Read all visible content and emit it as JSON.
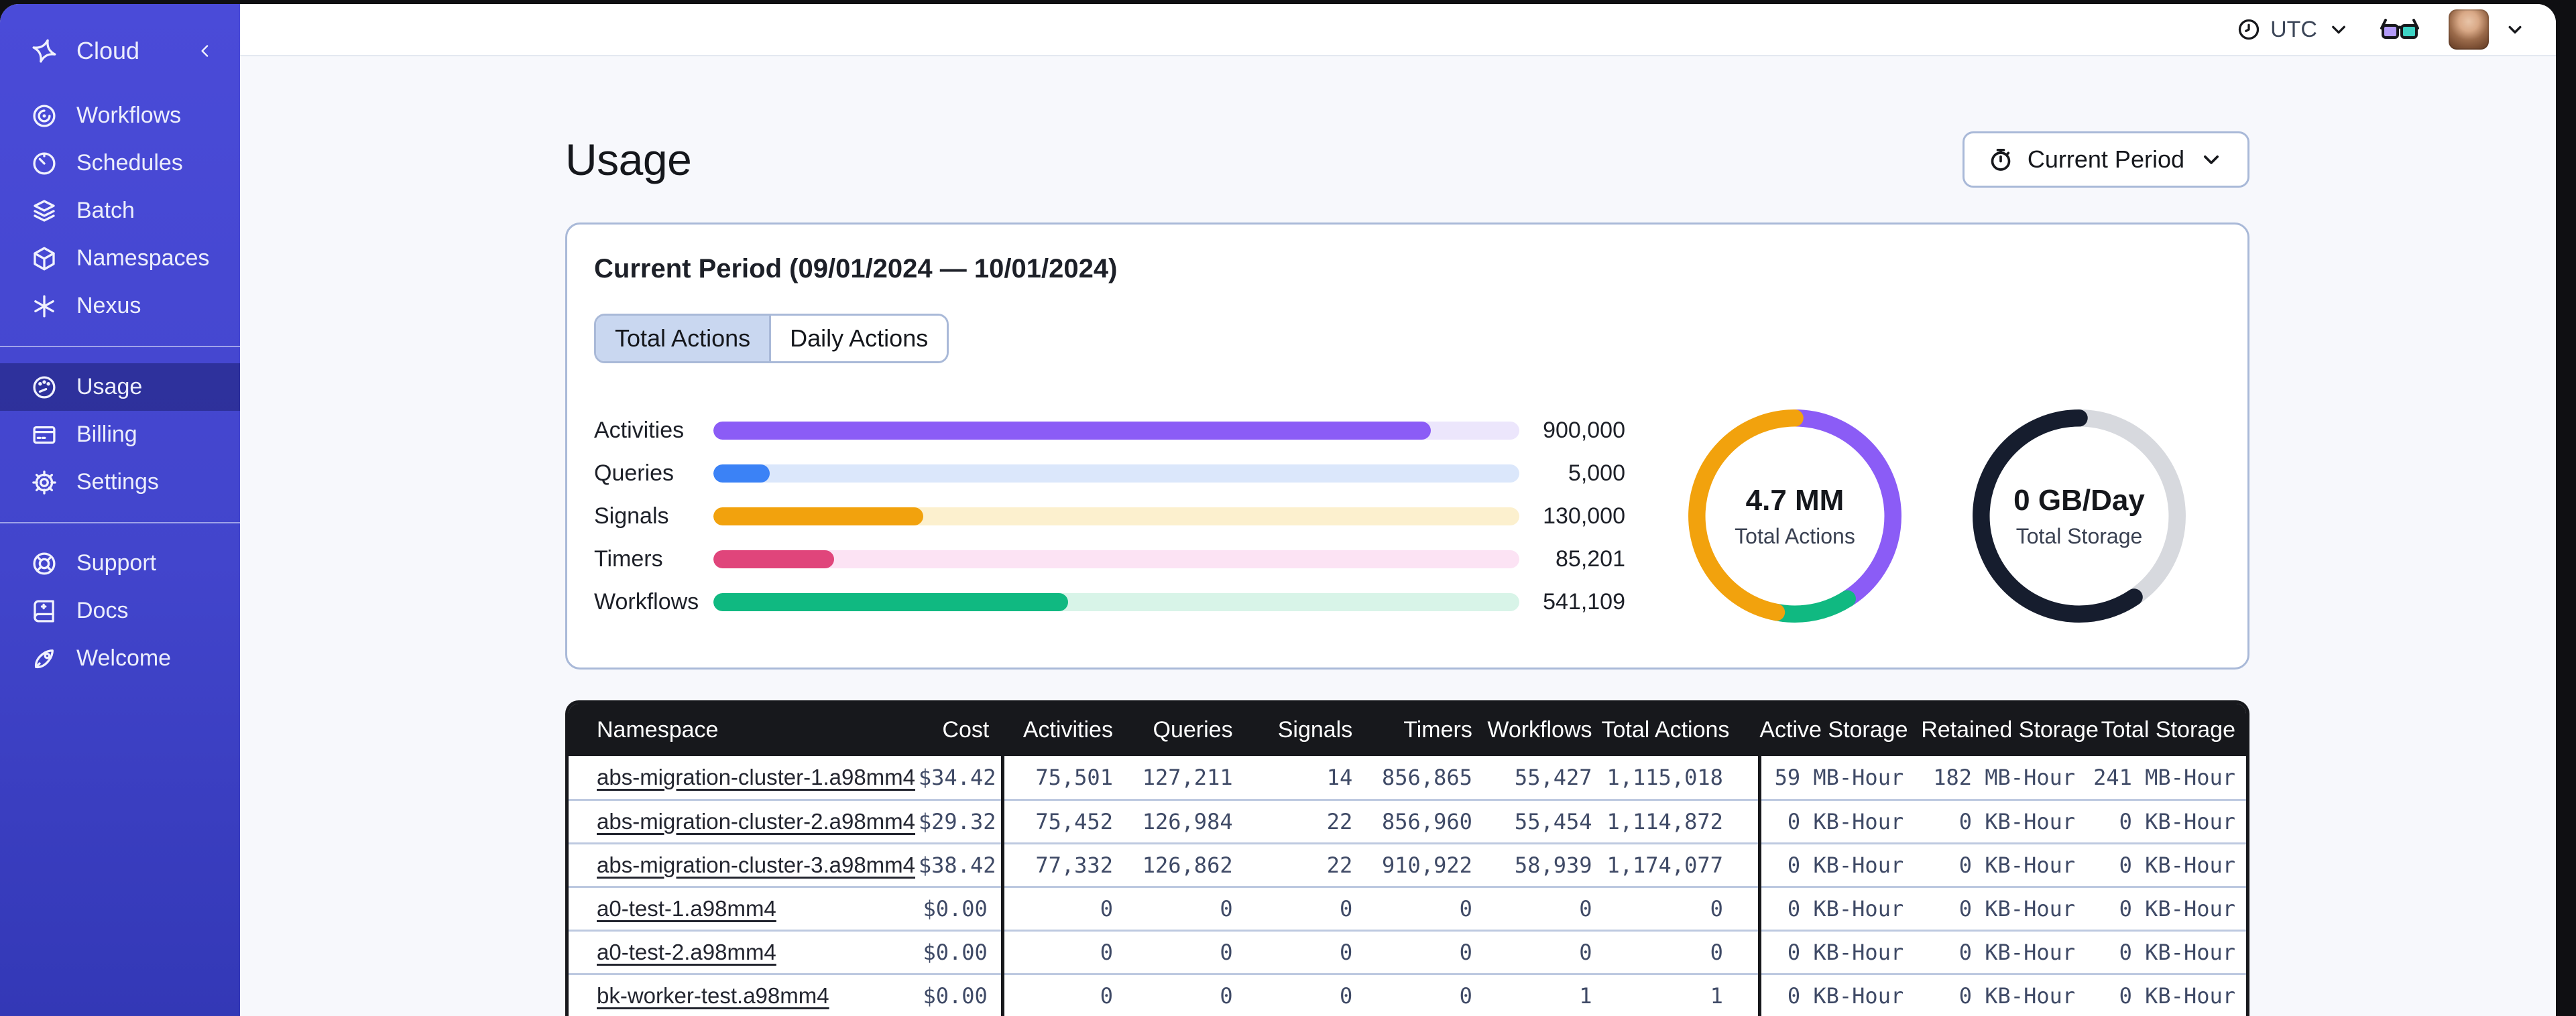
{
  "sidebar": {
    "brand": {
      "label": "Cloud"
    },
    "nav_main": [
      {
        "label": "Workflows",
        "icon": "workflows-icon"
      },
      {
        "label": "Schedules",
        "icon": "schedules-icon"
      },
      {
        "label": "Batch",
        "icon": "batch-icon"
      },
      {
        "label": "Namespaces",
        "icon": "namespaces-icon"
      },
      {
        "label": "Nexus",
        "icon": "nexus-icon"
      }
    ],
    "nav_account": [
      {
        "label": "Usage",
        "icon": "usage-gauge-icon",
        "active": true
      },
      {
        "label": "Billing",
        "icon": "billing-card-icon",
        "active": false
      },
      {
        "label": "Settings",
        "icon": "settings-gear-icon",
        "active": false
      }
    ],
    "nav_footer": [
      {
        "label": "Support",
        "icon": "support-lifebuoy-icon"
      },
      {
        "label": "Docs",
        "icon": "docs-book-icon"
      },
      {
        "label": "Welcome",
        "icon": "welcome-rocket-icon"
      }
    ]
  },
  "topbar": {
    "timezone": "UTC"
  },
  "page": {
    "title": "Usage",
    "period_button_label": "Current Period"
  },
  "usage_card": {
    "title": "Current Period (09/01/2024 — 10/01/2024)",
    "tabs": [
      {
        "label": "Total Actions",
        "active": true
      },
      {
        "label": "Daily Actions",
        "active": false
      }
    ],
    "chart_data": [
      {
        "type": "bar",
        "title": "Total Actions by type",
        "categories": [
          "Activities",
          "Queries",
          "Signals",
          "Timers",
          "Workflows"
        ],
        "values": [
          900000,
          5000,
          130000,
          85201,
          541109
        ],
        "display_values": [
          "900,000",
          "5,000",
          "130,000",
          "85,201",
          "541,109"
        ],
        "fill_percents": [
          89,
          7,
          26,
          15,
          44
        ],
        "colors": [
          "#8b5cf6",
          "#3b82f6",
          "#f2a20d",
          "#e0457b",
          "#10b981"
        ],
        "track_colors": [
          "#ece6fc",
          "#dbe7fb",
          "#fcf0ce",
          "#fce3f4",
          "#d8f4e8"
        ]
      },
      {
        "type": "pie",
        "title": "Total Actions donut",
        "center_value": "4.7 MM",
        "center_label": "Total Actions",
        "segments": [
          {
            "name": "purple",
            "color": "#8b5cf6",
            "percent": 41
          },
          {
            "name": "green",
            "color": "#10b981",
            "percent": 12
          },
          {
            "name": "orange",
            "color": "#f2a20d",
            "percent": 47
          }
        ]
      },
      {
        "type": "pie",
        "title": "Total Storage donut",
        "center_value": "0 GB/Day",
        "center_label": "Total Storage",
        "segments": [
          {
            "name": "remaining",
            "color": "#d7d9de",
            "percent": 40.5
          },
          {
            "name": "used",
            "color": "#161d2e",
            "percent": 59.5
          }
        ]
      }
    ]
  },
  "table": {
    "columns": [
      "Namespace",
      "Cost",
      "Activities",
      "Queries",
      "Signals",
      "Timers",
      "Workflows",
      "Total Actions",
      "Active Storage",
      "Retained Storage",
      "Total Storage"
    ],
    "rows": [
      [
        "abs-migration-cluster-1.a98mm4",
        "$34.42",
        "75,501",
        "127,211",
        "14",
        "856,865",
        "55,427",
        "1,115,018",
        "59 MB-Hour",
        "182 MB-Hour",
        "241 MB-Hour"
      ],
      [
        "abs-migration-cluster-2.a98mm4",
        "$29.32",
        "75,452",
        "126,984",
        "22",
        "856,960",
        "55,454",
        "1,114,872",
        "0 KB-Hour",
        "0 KB-Hour",
        "0 KB-Hour"
      ],
      [
        "abs-migration-cluster-3.a98mm4",
        "$38.42",
        "77,332",
        "126,862",
        "22",
        "910,922",
        "58,939",
        "1,174,077",
        "0 KB-Hour",
        "0 KB-Hour",
        "0 KB-Hour"
      ],
      [
        "a0-test-1.a98mm4",
        "$0.00",
        "0",
        "0",
        "0",
        "0",
        "0",
        "0",
        "0 KB-Hour",
        "0 KB-Hour",
        "0 KB-Hour"
      ],
      [
        "a0-test-2.a98mm4",
        "$0.00",
        "0",
        "0",
        "0",
        "0",
        "0",
        "0",
        "0 KB-Hour",
        "0 KB-Hour",
        "0 KB-Hour"
      ],
      [
        "bk-worker-test.a98mm4",
        "$0.00",
        "0",
        "0",
        "0",
        "0",
        "1",
        "1",
        "0 KB-Hour",
        "0 KB-Hour",
        "0 KB-Hour"
      ]
    ]
  }
}
